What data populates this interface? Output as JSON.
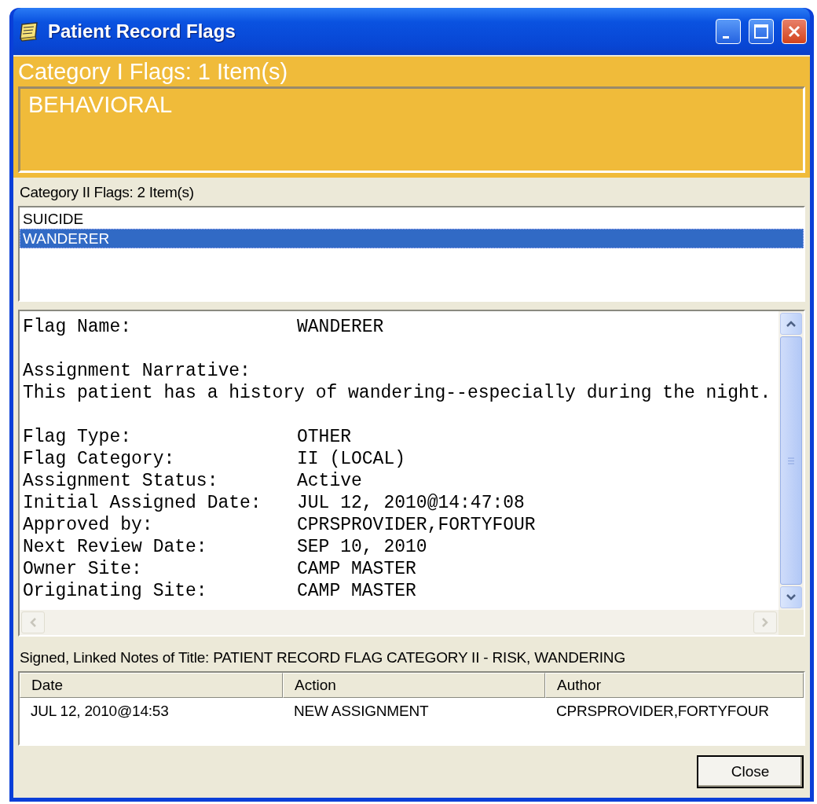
{
  "window": {
    "title": "Patient Record Flags"
  },
  "category_1": {
    "heading": "Category I Flags: 1 Item(s)",
    "items": [
      {
        "label": "BEHAVIORAL"
      }
    ]
  },
  "category_2": {
    "heading": "Category II Flags: 2 Item(s)",
    "items": [
      {
        "label": "SUICIDE",
        "selected": false
      },
      {
        "label": "WANDERER",
        "selected": true
      }
    ]
  },
  "details": {
    "sections": [
      {
        "kind": "fields",
        "rows": [
          {
            "label": "Flag Name:",
            "value": "WANDERER"
          }
        ]
      },
      {
        "kind": "narrative",
        "heading": "Assignment Narrative:",
        "text": "This patient has a history of wandering--especially during the night."
      },
      {
        "kind": "fields",
        "rows": [
          {
            "label": "Flag Type:",
            "value": "OTHER"
          },
          {
            "label": "Flag Category:",
            "value": "II (LOCAL)"
          },
          {
            "label": "Assignment Status:",
            "value": "Active"
          },
          {
            "label": "Initial Assigned Date:",
            "value": "JUL 12, 2010@14:47:08"
          },
          {
            "label": "Approved by:",
            "value": "CPRSPROVIDER,FORTYFOUR"
          },
          {
            "label": "Next Review Date:",
            "value": "SEP 10, 2010"
          },
          {
            "label": "Owner Site:",
            "value": "CAMP MASTER"
          },
          {
            "label": "Originating Site:",
            "value": "CAMP MASTER"
          }
        ]
      }
    ]
  },
  "notes": {
    "heading": "Signed, Linked Notes of Title: PATIENT RECORD FLAG CATEGORY II - RISK, WANDERING",
    "columns": [
      "Date",
      "Action",
      "Author"
    ],
    "rows": [
      [
        "JUL 12, 2010@14:53",
        "NEW ASSIGNMENT",
        "CPRSPROVIDER,FORTYFOUR"
      ]
    ]
  },
  "buttons": [
    {
      "label": "Close"
    }
  ]
}
